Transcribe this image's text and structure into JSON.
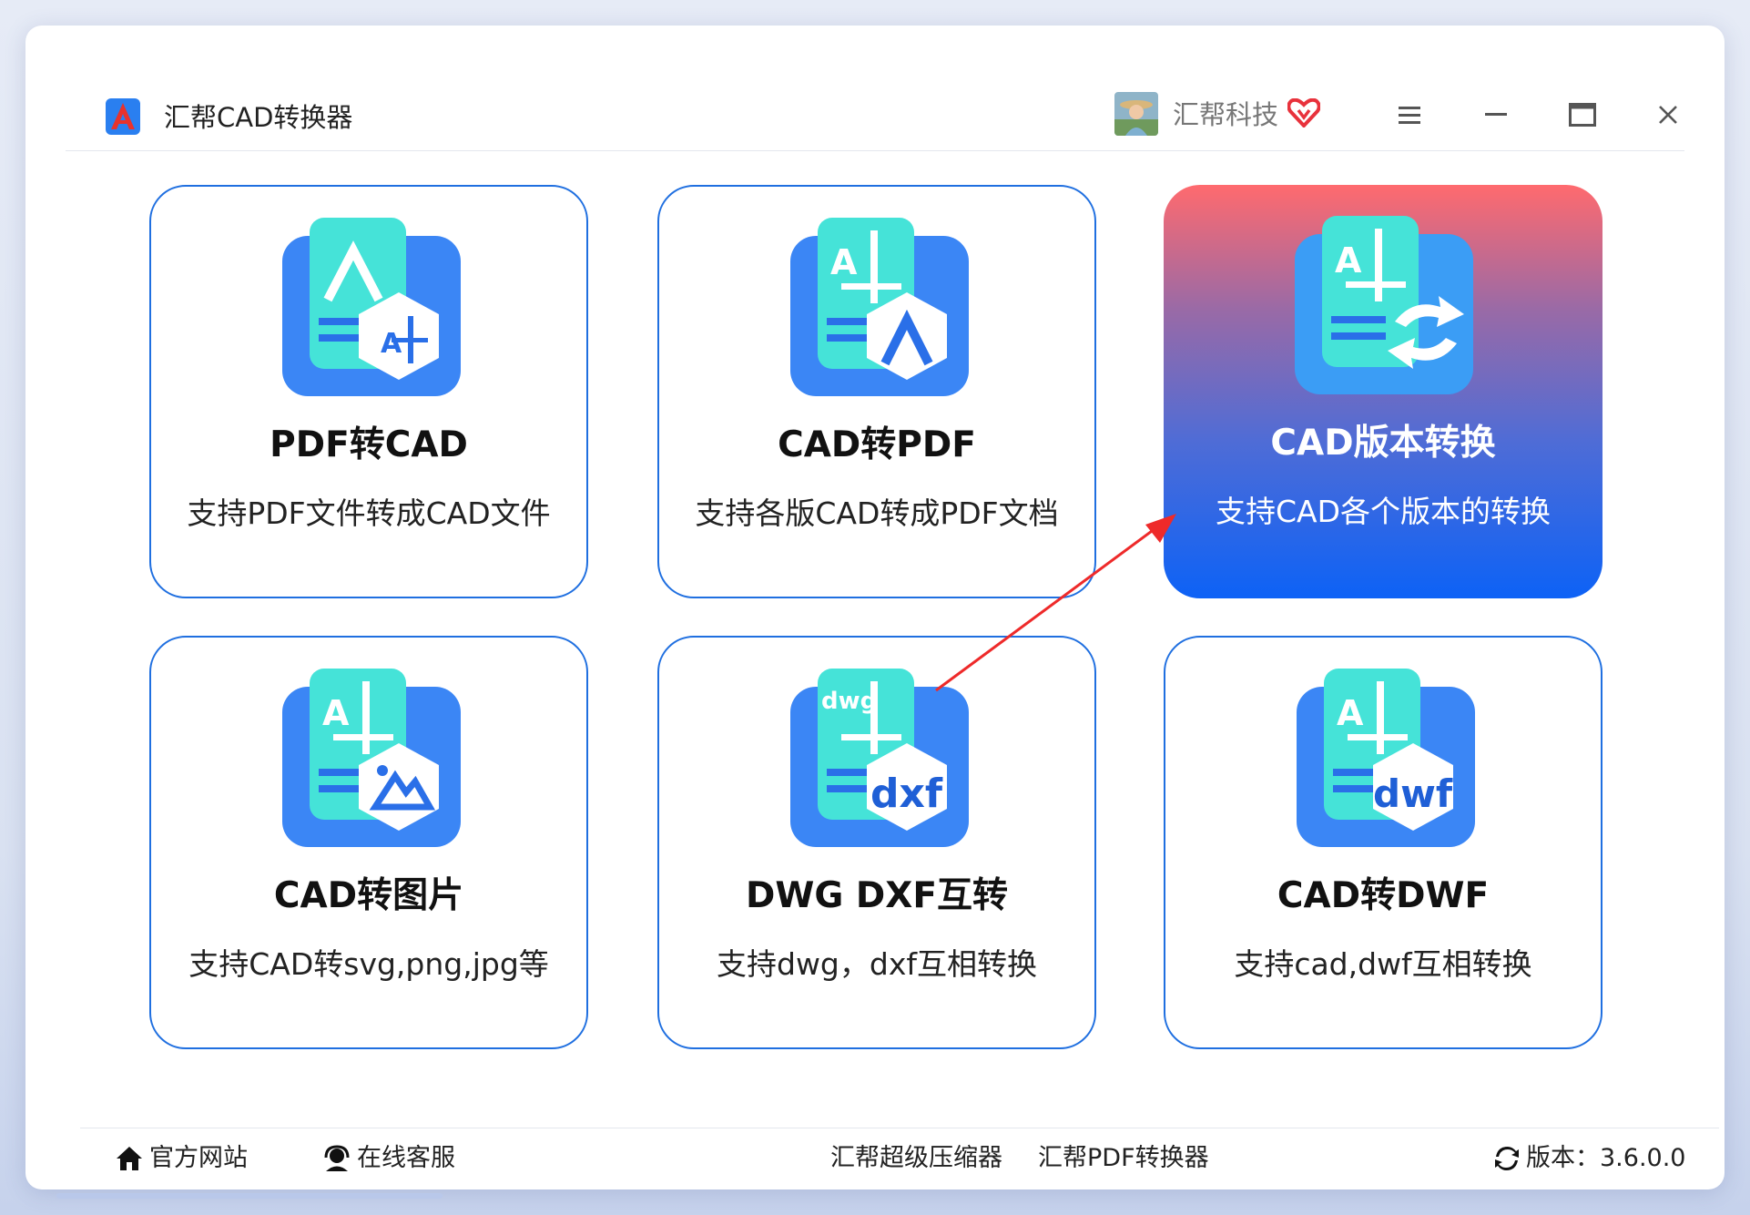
{
  "app": {
    "title": "汇帮CAD转换器",
    "user_name": "汇帮科技"
  },
  "cards": [
    {
      "title": "PDF转CAD",
      "desc": "支持PDF文件转成CAD文件",
      "icon": "pdf-to-cad-icon"
    },
    {
      "title": "CAD转PDF",
      "desc": "支持各版CAD转成PDF文档",
      "icon": "cad-to-pdf-icon"
    },
    {
      "title": "CAD版本转换",
      "desc": "支持CAD各个版本的转换",
      "icon": "version-convert-icon",
      "active": true
    },
    {
      "title": "CAD转图片",
      "desc": "支持CAD转svg,png,jpg等",
      "icon": "cad-to-image-icon"
    },
    {
      "title": "DWG DXF互转",
      "desc": "支持dwg，dxf互相转换",
      "icon": "dwg-dxf-icon",
      "badge": "dwg",
      "hex_text": "dxf"
    },
    {
      "title": "CAD转DWF",
      "desc": "支持cad,dwf互相转换",
      "icon": "cad-to-dwf-icon",
      "hex_text": "dwf"
    }
  ],
  "footer": {
    "official_site": "官方网站",
    "online_service": "在线客服",
    "compressor": "汇帮超级压缩器",
    "pdf_converter": "汇帮PDF转换器",
    "version": "版本：3.6.0.0"
  },
  "colors": {
    "accent": "#1f6fe0",
    "active_top": "#ff6a6e",
    "active_bottom": "#0d62f6",
    "icon_blue": "#3b86f5",
    "icon_cyan": "#45e3d8"
  }
}
